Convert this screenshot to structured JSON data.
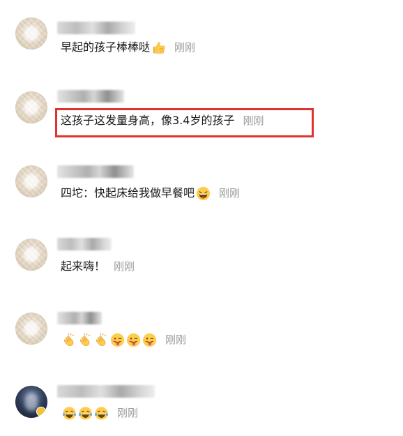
{
  "comments": [
    {
      "text": "早起的孩子棒棒哒",
      "emojis": [
        "thumbs-up-icon"
      ],
      "time": "刚刚"
    },
    {
      "text": "这孩子这发量身高，像3.4岁的孩子",
      "emojis": [],
      "time": "刚刚",
      "highlighted": true
    },
    {
      "text": "四坨：快起床给我做早餐吧",
      "emojis": [
        "laughing-face-icon"
      ],
      "time": "刚刚"
    },
    {
      "text": "起来嗨！",
      "emojis": [],
      "time": "刚刚"
    },
    {
      "text": "",
      "emojis": [
        "clapping-hands-icon",
        "clapping-hands-icon",
        "clapping-hands-icon",
        "winking-tongue-face-icon",
        "winking-tongue-face-icon",
        "winking-tongue-face-icon"
      ],
      "time": "刚刚"
    },
    {
      "text": "",
      "emojis": [
        "tears-of-joy-face-icon",
        "tears-of-joy-face-icon",
        "tears-of-joy-face-icon"
      ],
      "time": "刚刚"
    }
  ],
  "colors": {
    "highlight_border": "#e0322e",
    "timestamp": "#9a9a9a",
    "text": "#1a1a1a"
  }
}
